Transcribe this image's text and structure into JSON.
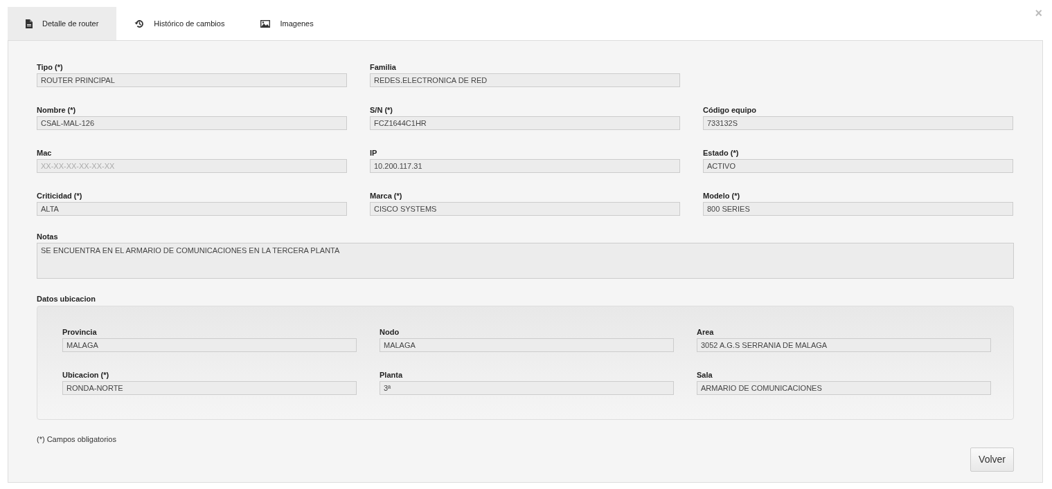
{
  "close_label": "×",
  "tabs": [
    {
      "label": "Detalle de router",
      "selected": true,
      "kind": "document"
    },
    {
      "label": "Histórico de cambios",
      "selected": false,
      "kind": "history"
    },
    {
      "label": "Imagenes",
      "selected": false,
      "kind": "image"
    }
  ],
  "field_rows": [
    [
      {
        "label": "Tipo (*)",
        "value": "ROUTER PRINCIPAL"
      },
      {
        "label": "Familia",
        "value": "REDES.ELECTRONICA DE RED"
      }
    ],
    [
      {
        "label": "Nombre (*)",
        "value": "CSAL-MAL-126"
      },
      {
        "label": "S/N (*)",
        "value": "FCZ1644C1HR"
      },
      {
        "label": "Código equipo",
        "value": "733132S"
      }
    ],
    [
      {
        "label": "Mac",
        "placeholder": "XX-XX-XX-XX-XX-XX"
      },
      {
        "label": "IP",
        "value": "10.200.117.31"
      },
      {
        "label": "Estado (*)",
        "value": "ACTIVO"
      }
    ],
    [
      {
        "label": "Criticidad (*)",
        "value": "ALTA"
      },
      {
        "label": "Marca (*)",
        "value": "CISCO SYSTEMS"
      },
      {
        "label": "Modelo (*)",
        "value": "800 SERIES"
      }
    ]
  ],
  "notes": {
    "label": "Notas",
    "value": "SE ENCUENTRA EN EL ARMARIO DE COMUNICACIONES EN LA TERCERA PLANTA"
  },
  "location": {
    "title": "Datos ubicacion",
    "rows": [
      [
        {
          "label": "Provincia",
          "value": "MALAGA"
        },
        {
          "label": "Nodo",
          "value": "MALAGA"
        },
        {
          "label": "Area",
          "value": "3052 A.G.S SERRANIA DE MALAGA"
        }
      ],
      [
        {
          "label": "Ubicacion (*)",
          "value": "RONDA-NORTE"
        },
        {
          "label": "Planta",
          "value": "3ª"
        },
        {
          "label": "Sala",
          "value": "ARMARIO DE COMUNICACIONES"
        }
      ]
    ]
  },
  "footnote": "(*) Campos obligatorios",
  "back_button": "Volver"
}
